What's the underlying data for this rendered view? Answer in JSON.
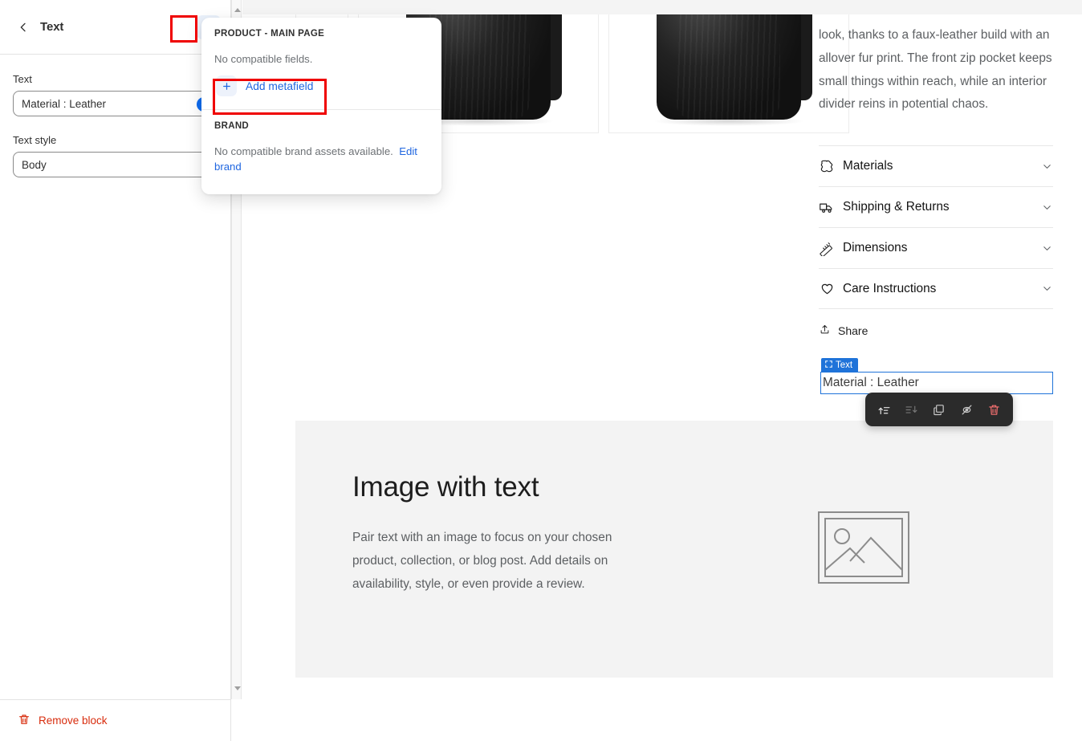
{
  "left_panel": {
    "title": "Text",
    "back_icon": "chevron-left-icon",
    "metafields_icon": "database-stack-icon",
    "fields": [
      {
        "label": "Text",
        "value": "Material : Leather",
        "kind": "text",
        "has_dynamic_source_badge": true
      },
      {
        "label": "Text style",
        "value": "Body",
        "kind": "select"
      }
    ],
    "footer": {
      "remove_label": "Remove block",
      "remove_icon": "trash-icon"
    },
    "scrollbar": {
      "up_icon": "scroll-up-arrow-icon",
      "down_icon": "scroll-down-arrow-icon"
    }
  },
  "popover": {
    "sections": [
      {
        "heading": "PRODUCT - MAIN PAGE",
        "note": "No compatible fields.",
        "action_label": "Add metafield",
        "action_icon": "plus-icon"
      },
      {
        "heading": "BRAND",
        "note": "No compatible brand assets available.",
        "link_label": "Edit brand"
      }
    ]
  },
  "preview": {
    "product": {
      "description": "look, thanks to a faux-leather build with an allover fur print. The front zip pocket keeps small things within reach, while an interior divider reins in potential chaos.",
      "accordion": [
        {
          "label": "Materials",
          "icon": "leather-hide-icon",
          "chevron": "chevron-down-icon"
        },
        {
          "label": "Shipping & Returns",
          "icon": "delivery-truck-icon",
          "chevron": "chevron-down-icon"
        },
        {
          "label": "Dimensions",
          "icon": "ruler-icon",
          "chevron": "chevron-down-icon"
        },
        {
          "label": "Care Instructions",
          "icon": "heart-icon",
          "chevron": "chevron-down-icon"
        }
      ],
      "share": {
        "label": "Share",
        "icon": "share-icon"
      }
    },
    "selected_block": {
      "tag_label": "Text",
      "tag_icon": "block-brackets-icon",
      "value": "Material : Leather"
    },
    "block_toolbar": {
      "buttons": [
        {
          "name": "move-up-icon",
          "label": "Move up",
          "state": "enabled"
        },
        {
          "name": "move-down-icon",
          "label": "Move down",
          "state": "disabled"
        },
        {
          "name": "duplicate-icon",
          "label": "Duplicate",
          "state": "enabled"
        },
        {
          "name": "hide-icon",
          "label": "Hide",
          "state": "enabled"
        },
        {
          "name": "delete-icon",
          "label": "Delete",
          "state": "danger"
        }
      ]
    },
    "image_with_text": {
      "heading": "Image with text",
      "paragraph": "Pair text with an image to focus on your chosen product, collection, or blog post. Add details on availability, style, or even provide a review.",
      "placeholder_icon": "image-placeholder-icon"
    }
  },
  "colors": {
    "accent_blue": "#1f66e0",
    "selection_blue": "#1f73d9",
    "annotation_red": "#ef0000",
    "danger_red": "#d82c0d",
    "toolbar_dark": "#2b2b2b"
  }
}
